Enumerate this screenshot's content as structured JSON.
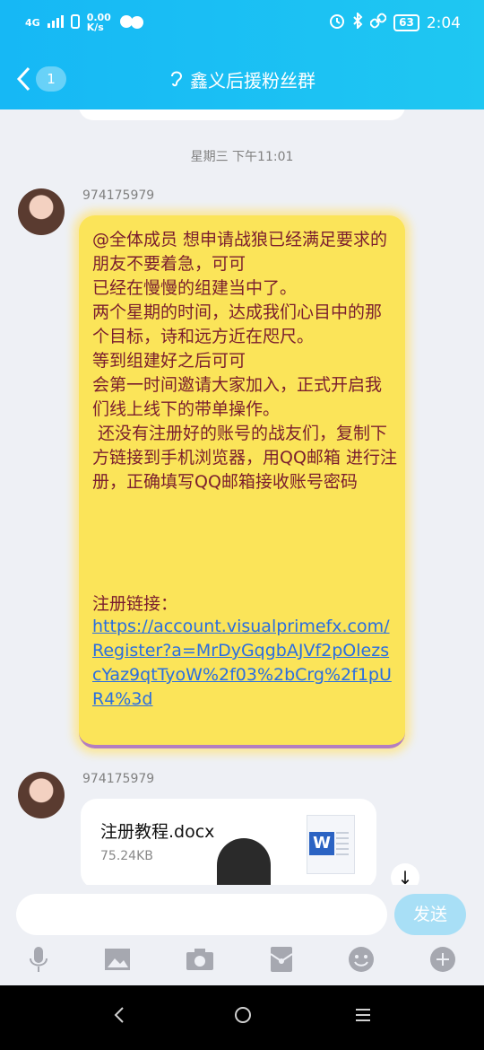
{
  "status": {
    "network": "4G",
    "speed": "0.00\nK/s",
    "battery": "63",
    "time": "2:04",
    "icons": [
      "signal-icon",
      "sim-icon",
      "wechat-icon",
      "alarm-icon",
      "bluetooth-icon",
      "link-icon"
    ]
  },
  "header": {
    "back_badge": "1",
    "title": "鑫义后援粉丝群",
    "title_icon": "ear-icon"
  },
  "chat": {
    "timestamp": "星期三  下午11:01",
    "messages": [
      {
        "sender": "974175979",
        "text": "@全体成员 想申请战狼已经满足要求的朋友不要着急，可可\n已经在慢慢的组建当中了。\n两个星期的时间，达成我们心目中的那个目标，诗和远方近在咫尺。\n等到组建好之后可可\n会第一时间邀请大家加入，正式开启我们线上线下的带单操作。\n 还没有注册好的账号的战友们，复制下方链接到手机浏览器，用QQ邮箱 进行注册，正确填写QQ邮箱接收账号密码",
        "link_label": "注册链接：",
        "link": "https://account.visualprimefx.com/Register?a=MrDyGqgbAJVf2pOlezscYaz9qtTyoW%2f03%2bCrg%2f1pUR4%3d"
      },
      {
        "sender": "974175979",
        "file_name": "注册教程.docx",
        "file_size": "75.24KB"
      }
    ]
  },
  "input": {
    "placeholder": "",
    "send_label": "发送",
    "tools": [
      "mic-icon",
      "image-icon",
      "camera-icon",
      "red-packet-icon",
      "emoji-icon",
      "plus-icon"
    ]
  },
  "nav": [
    "back-nav-icon",
    "home-nav-icon",
    "menu-nav-icon"
  ]
}
